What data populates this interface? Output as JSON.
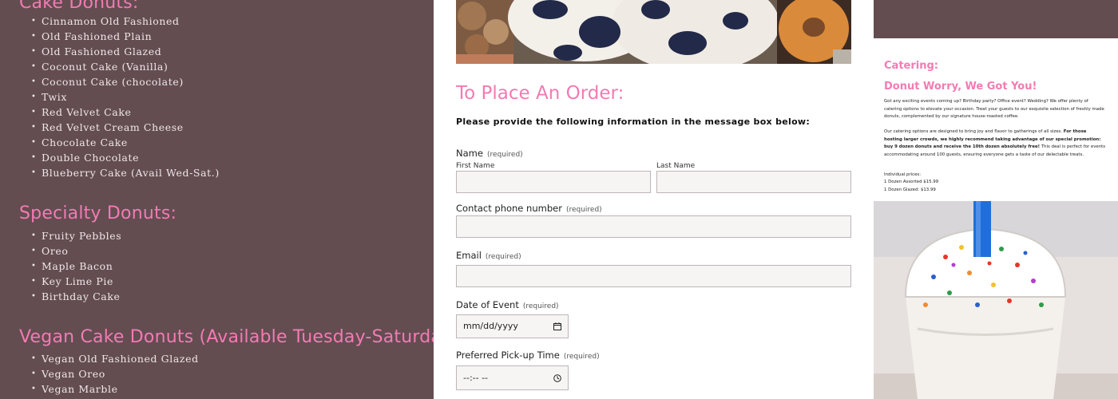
{
  "left": {
    "sections": [
      {
        "title": "Cake Donuts:",
        "items": [
          "Cinnamon Old Fashioned",
          "Old Fashioned Plain",
          "Old Fashioned Glazed",
          "Coconut Cake (Vanilla)",
          "Coconut Cake (chocolate)",
          "Twix",
          "Red Velvet Cake",
          "Red Velvet Cream Cheese",
          "Chocolate Cake",
          "Double Chocolate",
          "Blueberry Cake (Avail Wed-Sat.)"
        ]
      },
      {
        "title": "Specialty Donuts:",
        "items": [
          "Fruity Pebbles",
          "Oreo",
          "Maple Bacon",
          "Key Lime Pie",
          "Birthday Cake"
        ]
      },
      {
        "title": "Vegan Cake Donuts (Available Tuesday-Saturday)",
        "items": [
          "Vegan Old Fashioned Glazed",
          "Vegan Oreo",
          "Vegan Marble"
        ]
      }
    ]
  },
  "order": {
    "title": "To Place An Order:",
    "instructions": "Please provide the following information in the message box below:",
    "required_label": "(required)",
    "name_label": "Name",
    "first_name_label": "First Name",
    "last_name_label": "Last Name",
    "phone_label": "Contact phone number",
    "email_label": "Email",
    "date_label": "Date of Event",
    "date_placeholder": "mm/dd/yyyy",
    "time_label": "Preferred Pick-up Time",
    "time_placeholder": "--:-- --"
  },
  "catering": {
    "heading": "Catering:",
    "subheading": "Donut Worry, We Got You!",
    "paragraph1": "Got any exciting events coming up? Birthday party? Office event? Wedding? We offer plenty of catering options to elevate your occasion. Treat your guests to our exquisite selection of freshly made donuts, complemented by our signature house-roasted coffee.",
    "paragraph2_start": "Our catering options are designed to bring joy and flavor to gatherings of all sizes. ",
    "paragraph2_bold": "For those hosting larger crowds, we highly recommend taking advantage of our special promotion: buy 9 dozen donuts and receive the 10th dozen absolutely free!",
    "paragraph2_end": " This deal is perfect for events accommodating around 100 guests, ensuring everyone gets a taste of our delectable treats.",
    "prices_title": "Individual prices:",
    "price1": "1 Dozen Assorted $15.99",
    "price2": "1 Dozen Glazed: $13.99"
  },
  "colors": {
    "panel_bg": "#634d51",
    "accent_pink": "#f47ab3"
  }
}
